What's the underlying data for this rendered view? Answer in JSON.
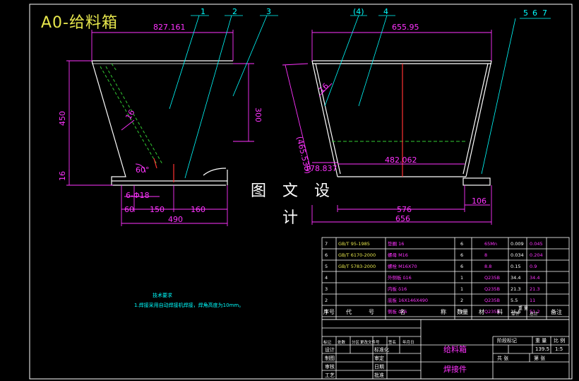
{
  "title": "A0-给料箱",
  "watermark": "图 文 设 计",
  "colors": {
    "bg": "#000000",
    "white": "#ffffff",
    "dim": "#ff33ff",
    "leader": "#00ffff",
    "green": "#33ff33",
    "yellow": "#e6e64c",
    "red": "#ff3333",
    "hidden": "#33cc33",
    "table": "#ffffff"
  },
  "left_view": {
    "top_width": "827.161",
    "height_a": "450",
    "height_b": "300",
    "slope_thk": "16",
    "small": "16",
    "angle": "60°",
    "holes": "6-Φ18",
    "seg1": "60",
    "seg2": "150",
    "seg3": "160",
    "bottom": "490",
    "balloons": [
      "1",
      "2",
      "3"
    ]
  },
  "right_view": {
    "top_width": "655.95",
    "slant": "(465.538)",
    "thk": "16",
    "offset": "178.837",
    "inner": "482.062",
    "base_a": "576",
    "base_b": "656",
    "side": "106",
    "balloons": [
      "(4)",
      "4",
      "5",
      "6",
      "7"
    ]
  },
  "notes": {
    "heading": "技术要求",
    "line1": "1.焊接采用自动焊接机焊接，焊角高度为10mm。"
  },
  "bom": {
    "rows": [
      {
        "no": "7",
        "code": "GB/T 95-1985",
        "name": "垫圈 16",
        "qty": "6",
        "mat": "65Mn",
        "w1": "0.009",
        "w2": "0.045"
      },
      {
        "no": "6",
        "code": "GB/T 6170-2000",
        "name": "螺母 M16",
        "qty": "6",
        "mat": "8",
        "w1": "0.034",
        "w2": "0.204"
      },
      {
        "no": "5",
        "code": "GB/T 5783-2000",
        "name": "螺栓 M16X70",
        "qty": "6",
        "mat": "8.8",
        "w1": "0.15",
        "w2": "0.9"
      },
      {
        "no": "4",
        "code": "",
        "name": "外侧板 δ16",
        "qty": "1",
        "mat": "Q235B",
        "w1": "34.4",
        "w2": "34.4"
      },
      {
        "no": "3",
        "code": "",
        "name": "内板 δ16",
        "qty": "1",
        "mat": "Q235B",
        "w1": "21.3",
        "w2": "21.3"
      },
      {
        "no": "2",
        "code": "",
        "name": "底板 16X146X490",
        "qty": "2",
        "mat": "Q235B",
        "w1": "5.5",
        "w2": "11"
      },
      {
        "no": "1",
        "code": "",
        "name": "侧板 δ16",
        "qty": "2",
        "mat": "Q235B",
        "w1": "25.6",
        "w2": "51.2"
      }
    ],
    "header": [
      "序号",
      "代",
      "号",
      "名",
      "称",
      "数量",
      "材",
      "料",
      "单件",
      "总计",
      "备注"
    ],
    "weight_label": "重 量"
  },
  "titleblock": {
    "name": "给料箱",
    "sub": "焊接件",
    "mark": "阶段标记",
    "weight": "重 量",
    "ratio": "比 例",
    "weight_val": "139.5",
    "ratio_val": "1:5",
    "sheets": "共    张",
    "sheet": "第    张",
    "left_rows": [
      "标记",
      "处数",
      "分区",
      "更改文件号",
      "签名",
      "年月日"
    ],
    "roles": [
      "设计",
      "制图",
      "审核",
      "工艺",
      "标准化",
      "批准",
      "日期"
    ],
    "role2": [
      "标准化",
      "审定",
      "日期"
    ]
  }
}
